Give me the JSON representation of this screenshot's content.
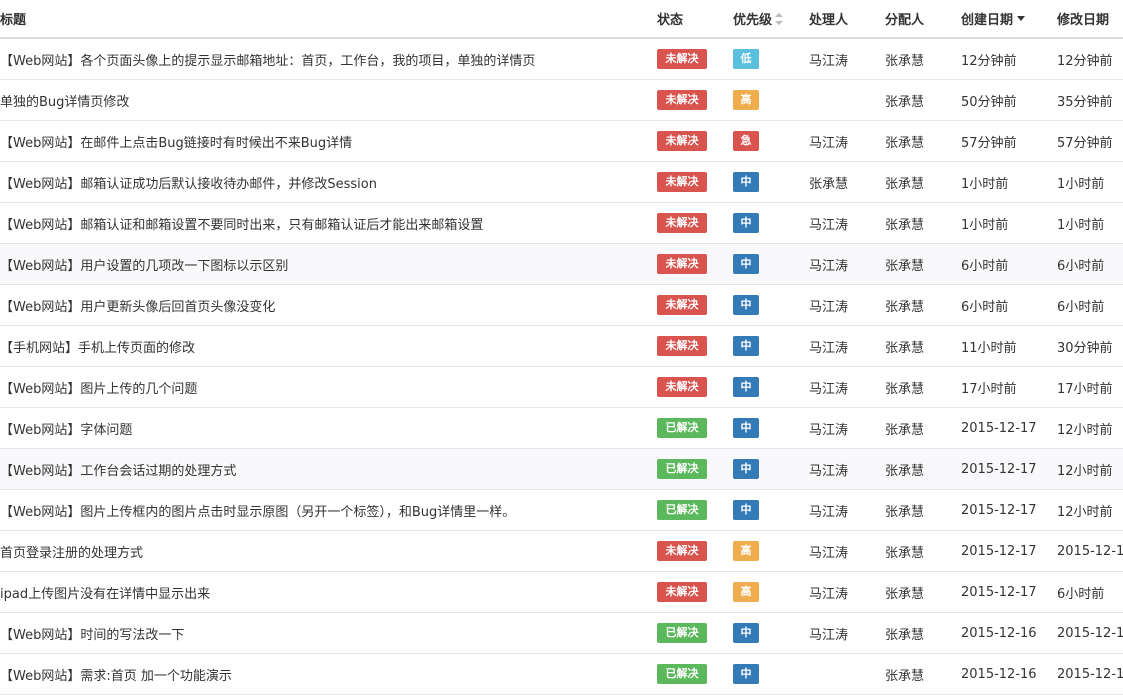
{
  "header": {
    "title": "标题",
    "status": "状态",
    "priority": "优先级",
    "handler": "处理人",
    "assignee": "分配人",
    "created": "创建日期",
    "modified": "修改日期"
  },
  "colors": {
    "unresolved": "#d9534f",
    "resolved": "#5cb85c",
    "low": "#5bc0de",
    "high": "#f0ad4e",
    "urgent": "#d9534f",
    "medium": "#337ab7"
  },
  "rows": [
    {
      "title": "【Web网站】各个页面头像上的提示显示邮箱地址：首页，工作台，我的项目，单独的详情页",
      "status": "未解决",
      "status_color": "#d9534f",
      "priority": "低",
      "priority_color": "#5bc0de",
      "handler": "马江涛",
      "assignee": "张承慧",
      "created": "12分钟前",
      "modified": "12分钟前"
    },
    {
      "title": "单独的Bug详情页修改",
      "status": "未解决",
      "status_color": "#d9534f",
      "priority": "高",
      "priority_color": "#f0ad4e",
      "handler": "",
      "assignee": "张承慧",
      "created": "50分钟前",
      "modified": "35分钟前"
    },
    {
      "title": "【Web网站】在邮件上点击Bug链接时有时候出不来Bug详情",
      "status": "未解决",
      "status_color": "#d9534f",
      "priority": "急",
      "priority_color": "#d9534f",
      "handler": "马江涛",
      "assignee": "张承慧",
      "created": "57分钟前",
      "modified": "57分钟前"
    },
    {
      "title": "【Web网站】邮箱认证成功后默认接收待办邮件，并修改Session",
      "status": "未解决",
      "status_color": "#d9534f",
      "priority": "中",
      "priority_color": "#337ab7",
      "handler": "张承慧",
      "assignee": "张承慧",
      "created": "1小时前",
      "modified": "1小时前"
    },
    {
      "title": "【Web网站】邮箱认证和邮箱设置不要同时出来，只有邮箱认证后才能出来邮箱设置",
      "status": "未解决",
      "status_color": "#d9534f",
      "priority": "中",
      "priority_color": "#337ab7",
      "handler": "马江涛",
      "assignee": "张承慧",
      "created": "1小时前",
      "modified": "1小时前"
    },
    {
      "title": "【Web网站】用户设置的几项改一下图标以示区别",
      "status": "未解决",
      "status_color": "#d9534f",
      "priority": "中",
      "priority_color": "#337ab7",
      "handler": "马江涛",
      "assignee": "张承慧",
      "created": "6小时前",
      "modified": "6小时前"
    },
    {
      "title": "【Web网站】用户更新头像后回首页头像没变化",
      "status": "未解决",
      "status_color": "#d9534f",
      "priority": "中",
      "priority_color": "#337ab7",
      "handler": "马江涛",
      "assignee": "张承慧",
      "created": "6小时前",
      "modified": "6小时前"
    },
    {
      "title": "【手机网站】手机上传页面的修改",
      "status": "未解决",
      "status_color": "#d9534f",
      "priority": "中",
      "priority_color": "#337ab7",
      "handler": "马江涛",
      "assignee": "张承慧",
      "created": "11小时前",
      "modified": "30分钟前"
    },
    {
      "title": "【Web网站】图片上传的几个问题",
      "status": "未解决",
      "status_color": "#d9534f",
      "priority": "中",
      "priority_color": "#337ab7",
      "handler": "马江涛",
      "assignee": "张承慧",
      "created": "17小时前",
      "modified": "17小时前"
    },
    {
      "title": "【Web网站】字体问题",
      "status": "已解决",
      "status_color": "#5cb85c",
      "priority": "中",
      "priority_color": "#337ab7",
      "handler": "马江涛",
      "assignee": "张承慧",
      "created": "2015-12-17",
      "modified": "12小时前"
    },
    {
      "title": "【Web网站】工作台会话过期的处理方式",
      "status": "已解决",
      "status_color": "#5cb85c",
      "priority": "中",
      "priority_color": "#337ab7",
      "handler": "马江涛",
      "assignee": "张承慧",
      "created": "2015-12-17",
      "modified": "12小时前"
    },
    {
      "title": "【Web网站】图片上传框内的图片点击时显示原图（另开一个标签），和Bug详情里一样。",
      "status": "已解决",
      "status_color": "#5cb85c",
      "priority": "中",
      "priority_color": "#337ab7",
      "handler": "马江涛",
      "assignee": "张承慧",
      "created": "2015-12-17",
      "modified": "12小时前"
    },
    {
      "title": "首页登录注册的处理方式",
      "status": "未解决",
      "status_color": "#d9534f",
      "priority": "高",
      "priority_color": "#f0ad4e",
      "handler": "马江涛",
      "assignee": "张承慧",
      "created": "2015-12-17",
      "modified": "2015-12-1"
    },
    {
      "title": "ipad上传图片没有在详情中显示出来",
      "status": "未解决",
      "status_color": "#d9534f",
      "priority": "高",
      "priority_color": "#f0ad4e",
      "handler": "马江涛",
      "assignee": "张承慧",
      "created": "2015-12-17",
      "modified": "6小时前"
    },
    {
      "title": "【Web网站】时间的写法改一下",
      "status": "已解决",
      "status_color": "#5cb85c",
      "priority": "中",
      "priority_color": "#337ab7",
      "handler": "马江涛",
      "assignee": "张承慧",
      "created": "2015-12-16",
      "modified": "2015-12-1"
    },
    {
      "title": "【Web网站】需求:首页 加一个功能演示",
      "status": "已解决",
      "status_color": "#5cb85c",
      "priority": "中",
      "priority_color": "#337ab7",
      "handler": "",
      "assignee": "张承慧",
      "created": "2015-12-16",
      "modified": "2015-12-1"
    }
  ]
}
